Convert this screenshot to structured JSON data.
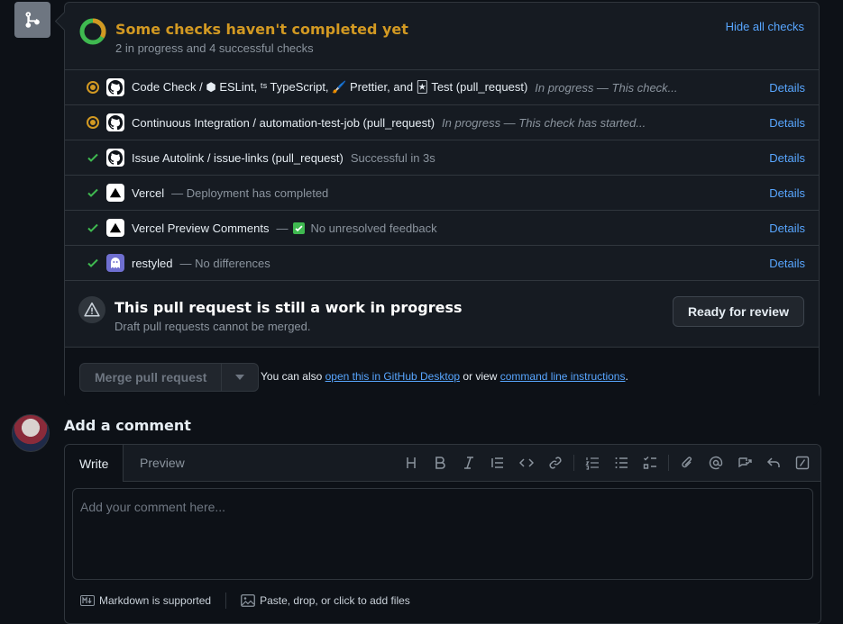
{
  "checks": {
    "title": "Some checks haven't completed yet",
    "subtitle": "2 in progress and 4 successful checks",
    "hide_label": "Hide all checks",
    "details_label": "Details",
    "rows": [
      {
        "name": "Code Check / ⬢ ESLint, ᵗˢ TypeScript, 🖌️ Prettier, and 🃏 Test (pull_request)",
        "desc": "In progress — This check...",
        "status": "in-progress"
      },
      {
        "name": "Continuous Integration / automation-test-job (pull_request)",
        "desc": "In progress — This check has started...",
        "status": "in-progress"
      },
      {
        "name": "Issue Autolink / issue-links (pull_request)",
        "desc": "Successful in 3s",
        "status": "success"
      },
      {
        "name": "Vercel",
        "desc": "— Deployment has completed",
        "status": "success"
      },
      {
        "name": "Vercel Preview Comments",
        "desc_prefix": "—",
        "desc": "No unresolved feedback",
        "status": "success"
      },
      {
        "name": "restyled",
        "desc": "— No differences",
        "status": "success"
      }
    ]
  },
  "wip": {
    "title": "This pull request is still a work in progress",
    "subtitle": "Draft pull requests cannot be merged.",
    "ready_label": "Ready for review"
  },
  "merge": {
    "button_label": "Merge pull request",
    "note_prefix": "You can also",
    "desktop_link": "open this in GitHub Desktop",
    "note_middle": "or view",
    "cli_link": "command line instructions",
    "note_suffix": "."
  },
  "comment": {
    "title": "Add a comment",
    "tab_write": "Write",
    "tab_preview": "Preview",
    "placeholder": "Add your comment here...",
    "markdown_note": "Markdown is supported",
    "attach_note": "Paste, drop, or click to add files"
  },
  "colors": {
    "accent": "#58a6ff",
    "pending": "#d29922",
    "success": "#3fb950",
    "background": "#0d1117"
  }
}
